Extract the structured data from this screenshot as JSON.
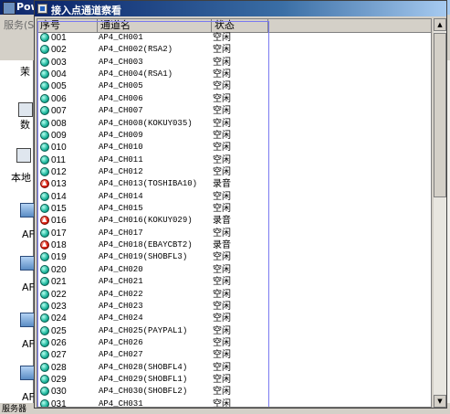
{
  "background_app": {
    "title": "Pow",
    "menu": "服务(S",
    "left_labels": [
      "茉",
      "数",
      "本地",
      "AF",
      "AF",
      "AF",
      "AF",
      "AF"
    ],
    "status_label": "服务器"
  },
  "dialog": {
    "title": "接入点通道察看",
    "columns": [
      "序号",
      "通道名",
      "状态"
    ]
  },
  "channels": [
    {
      "id": "001",
      "name": "AP4_CH001",
      "state": "空闲",
      "status": "idle"
    },
    {
      "id": "002",
      "name": "AP4_CH002(RSA2)",
      "state": "空闲",
      "status": "idle"
    },
    {
      "id": "003",
      "name": "AP4_CH003",
      "state": "空闲",
      "status": "idle"
    },
    {
      "id": "004",
      "name": "AP4_CH004(RSA1)",
      "state": "空闲",
      "status": "idle"
    },
    {
      "id": "005",
      "name": "AP4_CH005",
      "state": "空闲",
      "status": "idle"
    },
    {
      "id": "006",
      "name": "AP4_CH006",
      "state": "空闲",
      "status": "idle"
    },
    {
      "id": "007",
      "name": "AP4_CH007",
      "state": "空闲",
      "status": "idle"
    },
    {
      "id": "008",
      "name": "AP4_CH008(KOKUY035)",
      "state": "空闲",
      "status": "idle"
    },
    {
      "id": "009",
      "name": "AP4_CH009",
      "state": "空闲",
      "status": "idle"
    },
    {
      "id": "010",
      "name": "AP4_CH010",
      "state": "空闲",
      "status": "idle"
    },
    {
      "id": "011",
      "name": "AP4_CH011",
      "state": "空闲",
      "status": "idle"
    },
    {
      "id": "012",
      "name": "AP4_CH012",
      "state": "空闲",
      "status": "idle"
    },
    {
      "id": "013",
      "name": "AP4_CH013(TOSHIBA10)",
      "state": "录音",
      "status": "recording"
    },
    {
      "id": "014",
      "name": "AP4_CH014",
      "state": "空闲",
      "status": "idle"
    },
    {
      "id": "015",
      "name": "AP4_CH015",
      "state": "空闲",
      "status": "idle"
    },
    {
      "id": "016",
      "name": "AP4_CH016(KOKUY029)",
      "state": "录音",
      "status": "recording"
    },
    {
      "id": "017",
      "name": "AP4_CH017",
      "state": "空闲",
      "status": "idle"
    },
    {
      "id": "018",
      "name": "AP4_CH018(EBAYCBT2)",
      "state": "录音",
      "status": "recording"
    },
    {
      "id": "019",
      "name": "AP4_CH019(SHOBFL3)",
      "state": "空闲",
      "status": "idle"
    },
    {
      "id": "020",
      "name": "AP4_CH020",
      "state": "空闲",
      "status": "idle"
    },
    {
      "id": "021",
      "name": "AP4_CH021",
      "state": "空闲",
      "status": "idle"
    },
    {
      "id": "022",
      "name": "AP4_CH022",
      "state": "空闲",
      "status": "idle"
    },
    {
      "id": "023",
      "name": "AP4_CH023",
      "state": "空闲",
      "status": "idle"
    },
    {
      "id": "024",
      "name": "AP4_CH024",
      "state": "空闲",
      "status": "idle"
    },
    {
      "id": "025",
      "name": "AP4_CH025(PAYPAL1)",
      "state": "空闲",
      "status": "idle"
    },
    {
      "id": "026",
      "name": "AP4_CH026",
      "state": "空闲",
      "status": "idle"
    },
    {
      "id": "027",
      "name": "AP4_CH027",
      "state": "空闲",
      "status": "idle"
    },
    {
      "id": "028",
      "name": "AP4_CH028(SHOBFL4)",
      "state": "空闲",
      "status": "idle"
    },
    {
      "id": "029",
      "name": "AP4_CH029(SHOBFL1)",
      "state": "空闲",
      "status": "idle"
    },
    {
      "id": "030",
      "name": "AP4_CH030(SHOBFL2)",
      "state": "空闲",
      "status": "idle"
    },
    {
      "id": "031",
      "name": "AP4_CH031",
      "state": "空闲",
      "status": "idle"
    }
  ]
}
